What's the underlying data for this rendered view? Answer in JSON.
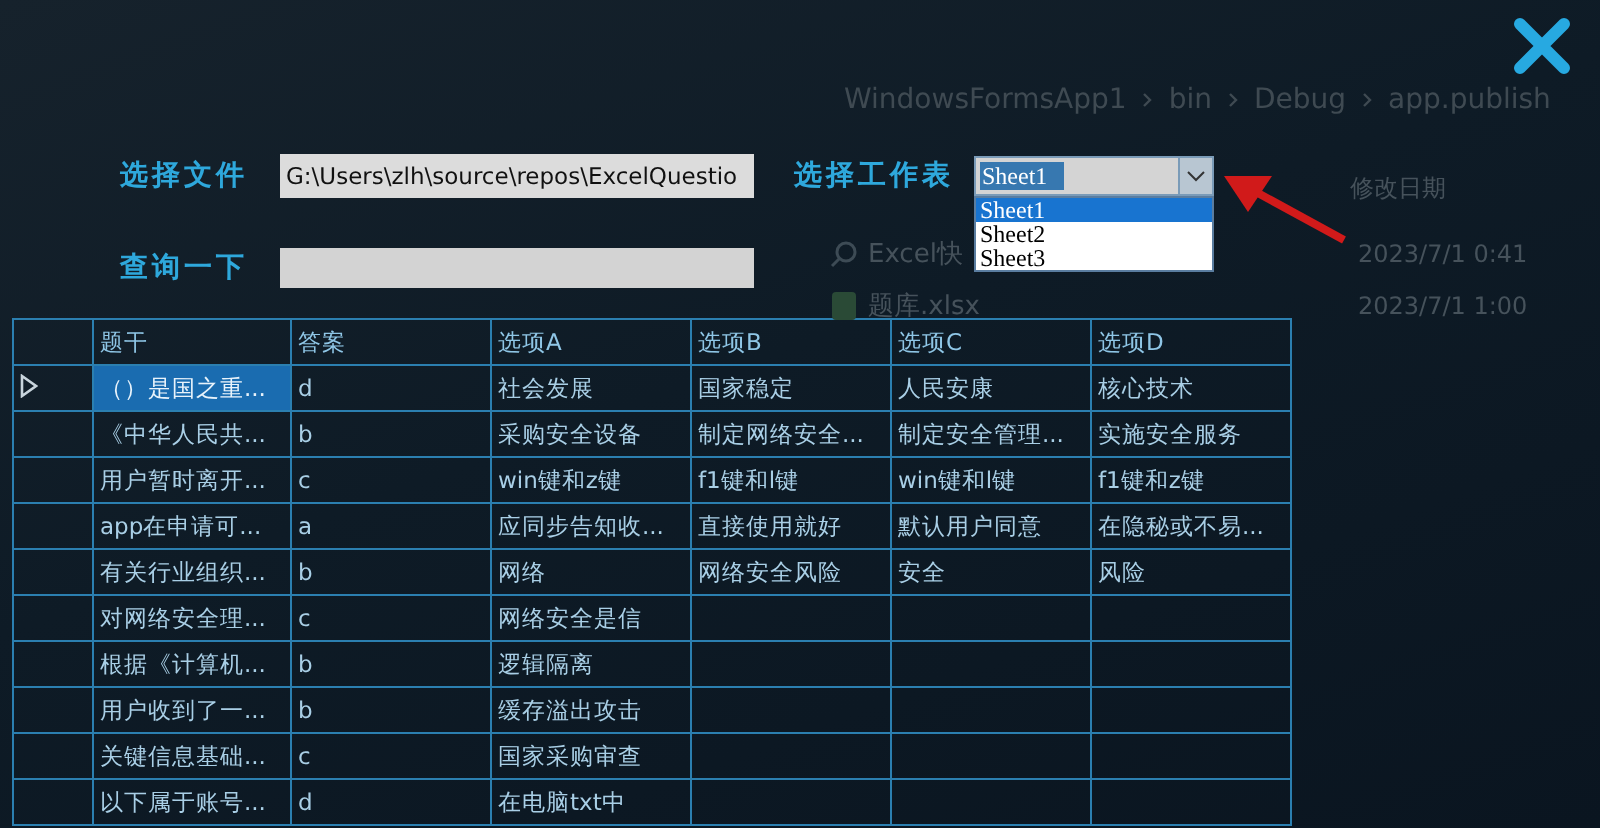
{
  "background_window": {
    "breadcrumb": [
      "WindowsFormsApp1",
      "bin",
      "Debug",
      "app.publish"
    ],
    "column_header": "修改日期",
    "items": [
      {
        "name": "Excel快",
        "date": "2023/7/1 0:41",
        "kind": "search"
      },
      {
        "name": "题库.xlsx",
        "date": "2023/7/1 1:00",
        "kind": "excel"
      }
    ]
  },
  "form": {
    "file_label": "选择文件",
    "file_path": "G:\\Users\\zlh\\source\\repos\\ExcelQuestio",
    "query_label": "查询一下",
    "sheet_label": "选择工作表",
    "sheet_value": "Sheet1",
    "sheet_expanded": true,
    "sheet_options": [
      {
        "label": "Sheet1",
        "selected": true
      },
      {
        "label": "Sheet2",
        "selected": false
      },
      {
        "label": "Sheet3",
        "selected": false
      }
    ]
  },
  "table": {
    "columns": [
      "题干",
      "答案",
      "选项A",
      "选项B",
      "选项C",
      "选项D"
    ],
    "rows": [
      {
        "selected": true,
        "cells": [
          "（）是国之重...",
          "d",
          "社会发展",
          "国家稳定",
          "人民安康",
          "核心技术"
        ]
      },
      {
        "selected": false,
        "cells": [
          "《中华人民共...",
          "b",
          "采购安全设备",
          "制定网络安全...",
          "制定安全管理...",
          "实施安全服务"
        ]
      },
      {
        "selected": false,
        "cells": [
          "用户暂时离开...",
          "c",
          "win键和z键",
          "f1键和l键",
          "win键和l键",
          "f1键和z键"
        ]
      },
      {
        "selected": false,
        "cells": [
          "app在申请可...",
          "a",
          "应同步告知收...",
          "直接使用就好",
          "默认用户同意",
          "在隐秘或不易..."
        ]
      },
      {
        "selected": false,
        "cells": [
          "有关行业组织...",
          "b",
          "网络",
          "网络安全风险",
          "安全",
          "风险"
        ]
      },
      {
        "selected": false,
        "cells": [
          "对网络安全理...",
          "c",
          "网络安全是信",
          "",
          "",
          ""
        ]
      },
      {
        "selected": false,
        "cells": [
          "根据《计算机...",
          "b",
          "逻辑隔离",
          "",
          "",
          ""
        ]
      },
      {
        "selected": false,
        "cells": [
          "用户收到了一...",
          "b",
          "缓存溢出攻击",
          "",
          "",
          ""
        ]
      },
      {
        "selected": false,
        "cells": [
          "关键信息基础...",
          "c",
          "国家采购审查",
          "",
          "",
          ""
        ]
      },
      {
        "selected": false,
        "cells": [
          "以下属于账号...",
          "d",
          "在电脑txt中",
          "",
          "",
          ""
        ]
      }
    ]
  }
}
